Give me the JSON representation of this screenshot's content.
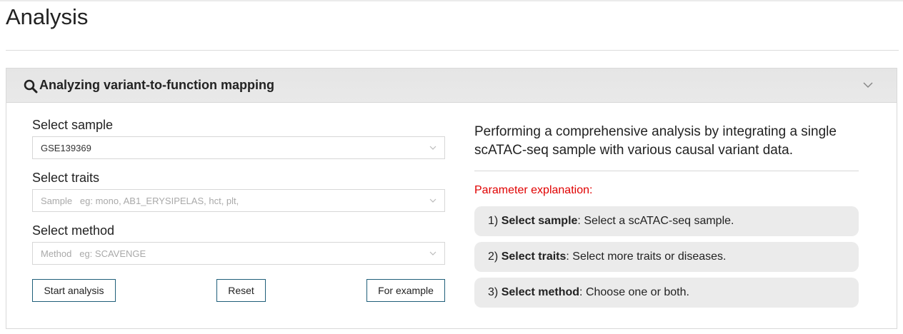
{
  "page": {
    "title": "Analysis"
  },
  "panel": {
    "title": "Analyzing variant-to-function mapping",
    "icon": "search-icon",
    "collapse_icon": "chevron-down-icon"
  },
  "form": {
    "sample": {
      "label": "Select sample",
      "value": "GSE139369"
    },
    "traits": {
      "label": "Select traits",
      "placeholder_prefix": "Sample",
      "placeholder": "eg: mono, AB1_ERYSIPELAS, hct, plt,"
    },
    "method": {
      "label": "Select method",
      "placeholder_prefix": "Method",
      "placeholder": "eg: SCAVENGE"
    },
    "buttons": {
      "start": "Start analysis",
      "reset": "Reset",
      "example": "For example"
    }
  },
  "info": {
    "intro": "Performing a comprehensive analysis by integrating a single scATAC-seq sample with various causal variant data.",
    "param_heading": "Parameter explanation:",
    "params": [
      {
        "num": "1)",
        "name": "Select sample",
        "desc": ": Select a scATAC-seq sample."
      },
      {
        "num": "2)",
        "name": "Select traits",
        "desc": ": Select more traits or diseases."
      },
      {
        "num": "3)",
        "name": "Select method",
        "desc": ": Choose one or both."
      }
    ]
  },
  "colors": {
    "accent_border": "#1f5f7a",
    "param_heading": "#e00000",
    "header_bg": "#e6e6e6"
  }
}
